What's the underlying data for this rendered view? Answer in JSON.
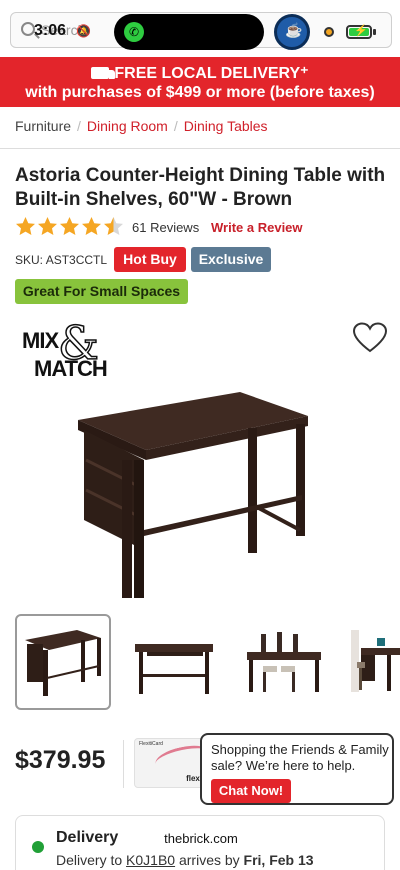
{
  "status_bar": {
    "time": "3:06",
    "search_placeholder": "Search"
  },
  "promo": {
    "line1": "FREE LOCAL DELIVERY⁺",
    "line2": "with purchases of $499 or more (before taxes)"
  },
  "breadcrumb": {
    "items": [
      "Furniture",
      "Dining Room",
      "Dining Tables"
    ]
  },
  "product": {
    "title": "Astoria Counter-Height Dining Table with Built-in Shelves, 60\"W - Brown",
    "rating": 4.5,
    "reviews_label": "61 Reviews",
    "write_review_label": "Write a Review",
    "sku_label": "SKU:",
    "sku_value": "AST3CCTL",
    "badges": {
      "hot_buy": "Hot Buy",
      "exclusive": "Exclusive",
      "small_spaces": "Great For Small Spaces"
    },
    "price": "$379.95"
  },
  "logo": {
    "line1": "MIX",
    "amp": "&",
    "line2": "MATCH"
  },
  "card": {
    "brand_small": "FlexitiCard",
    "brand": "flexiti"
  },
  "chat": {
    "message": "Shopping the Friends & Family sale? We’re here to help.",
    "button": "Chat Now!"
  },
  "delivery": {
    "label": "Delivery",
    "prefix": "Delivery to ",
    "postal_code": "K0J1B0",
    "middle": " arrives by ",
    "date": "Fri, Feb 13"
  },
  "url_label": "thebrick.com",
  "colors": {
    "brand_red": "#e3252b",
    "link_red": "#d0202a",
    "exclusive_blue": "#5c7a93",
    "small_spaces_green": "#88c33c",
    "star": "#f5a623"
  }
}
